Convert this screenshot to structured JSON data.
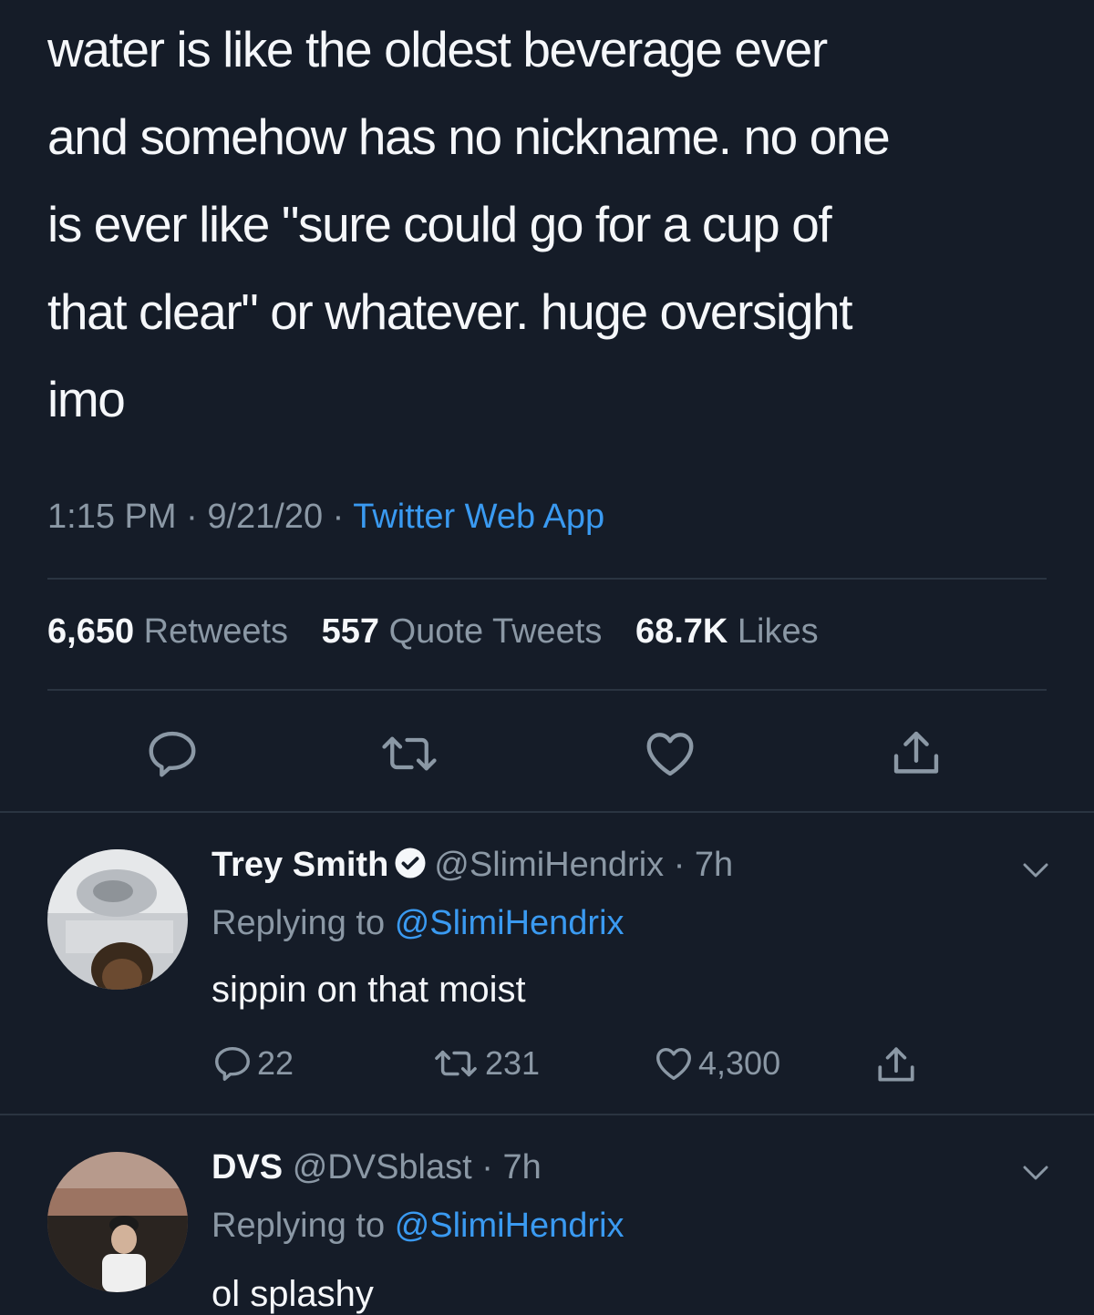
{
  "tweet": {
    "text_lines": [
      "water is like the oldest beverage ever",
      "and somehow has no nickname. no one",
      "is ever like \"sure could go for a cup of",
      "that clear\" or whatever. huge oversight",
      "imo"
    ],
    "time": "1:15 PM",
    "date": "9/21/20",
    "separator": "·",
    "source": "Twitter Web App",
    "stats": {
      "retweets_count": "6,650",
      "retweets_label": "Retweets",
      "quotes_count": "557",
      "quotes_label": "Quote Tweets",
      "likes_count": "68.7K",
      "likes_label": "Likes"
    },
    "actions": {
      "reply_icon": "speech-bubble-icon",
      "retweet_icon": "retweet-arrows-icon",
      "like_icon": "heart-icon",
      "share_icon": "share-upload-icon"
    }
  },
  "replies": [
    {
      "name": "Trey Smith",
      "verified": true,
      "handle": "@SlimiHendrix",
      "time": "7h",
      "replying_prefix": "Replying to",
      "replying_to": "@SlimiHendrix",
      "text": "sippin on that moist",
      "replies": "22",
      "retweets": "231",
      "likes": "4,300"
    },
    {
      "name": "DVS",
      "verified": false,
      "handle": "@DVSblast",
      "time": "7h",
      "replying_prefix": "Replying to",
      "replying_to": "@SlimiHendrix",
      "text": "ol splashy"
    }
  ],
  "colors": {
    "background": "#151c28",
    "text_primary": "#f5f7fa",
    "text_secondary": "#8b98a5",
    "link": "#3a9af1",
    "divider": "#2a3441"
  }
}
